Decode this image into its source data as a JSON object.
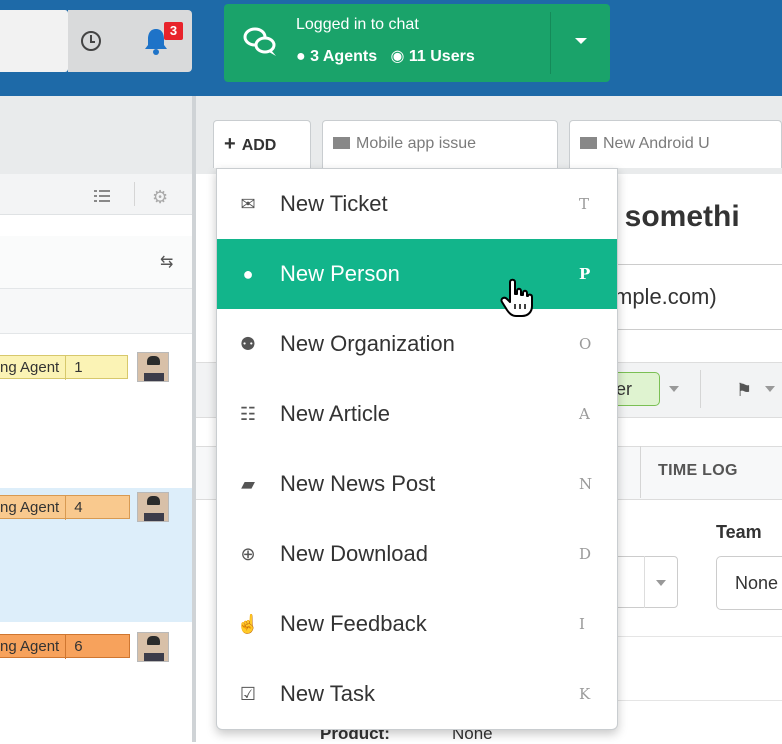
{
  "topbar": {
    "bell_badge": "3",
    "chat": {
      "title": "Logged in to chat",
      "agents": "3 Agents",
      "users": "11 Users",
      "icons": [
        "chat-bubbles-icon",
        "person-icon",
        "globe-icon",
        "caret-down-icon"
      ]
    },
    "icons": [
      "clock-icon",
      "bell-icon"
    ]
  },
  "tabs": [
    {
      "label": "ADD",
      "icon": "plus-icon"
    },
    {
      "label": "Mobile app issue",
      "icon": "envelope-icon"
    },
    {
      "label": "New Android U",
      "icon": "envelope-icon"
    }
  ],
  "left_panel": {
    "items": [
      {
        "agent": "ng Agent",
        "count": "1",
        "color": "#fbf3b5"
      },
      {
        "agent": "ng Agent",
        "count": "4",
        "color": "#f9c98e"
      },
      {
        "agent": "ng Agent",
        "count": "6",
        "color": "#f7a25c"
      }
    ]
  },
  "main": {
    "headline": "n somethi",
    "email": "mple.com)",
    "user_pill": "ser",
    "tab_timelog": "TIME LOG",
    "team_label": "Team",
    "team_value": "None",
    "product_label": "Product:",
    "product_value": "None"
  },
  "add_menu": {
    "items": [
      {
        "label": "New Ticket",
        "key": "T",
        "icon": "envelope-icon",
        "glyph": "✉"
      },
      {
        "label": "New Person",
        "key": "P",
        "icon": "person-icon",
        "glyph": "●",
        "active": true
      },
      {
        "label": "New Organization",
        "key": "O",
        "icon": "group-icon",
        "glyph": "⚉"
      },
      {
        "label": "New Article",
        "key": "A",
        "icon": "document-icon",
        "glyph": "☷"
      },
      {
        "label": "New News Post",
        "key": "N",
        "icon": "book-icon",
        "glyph": "▰"
      },
      {
        "label": "New Download",
        "key": "D",
        "icon": "download-icon",
        "glyph": "⊕"
      },
      {
        "label": "New Feedback",
        "key": "I",
        "icon": "thumbs-up-icon",
        "glyph": "☝"
      },
      {
        "label": "New Task",
        "key": "K",
        "icon": "checkbox-icon",
        "glyph": "☑"
      }
    ],
    "accent": "#12b58b"
  }
}
